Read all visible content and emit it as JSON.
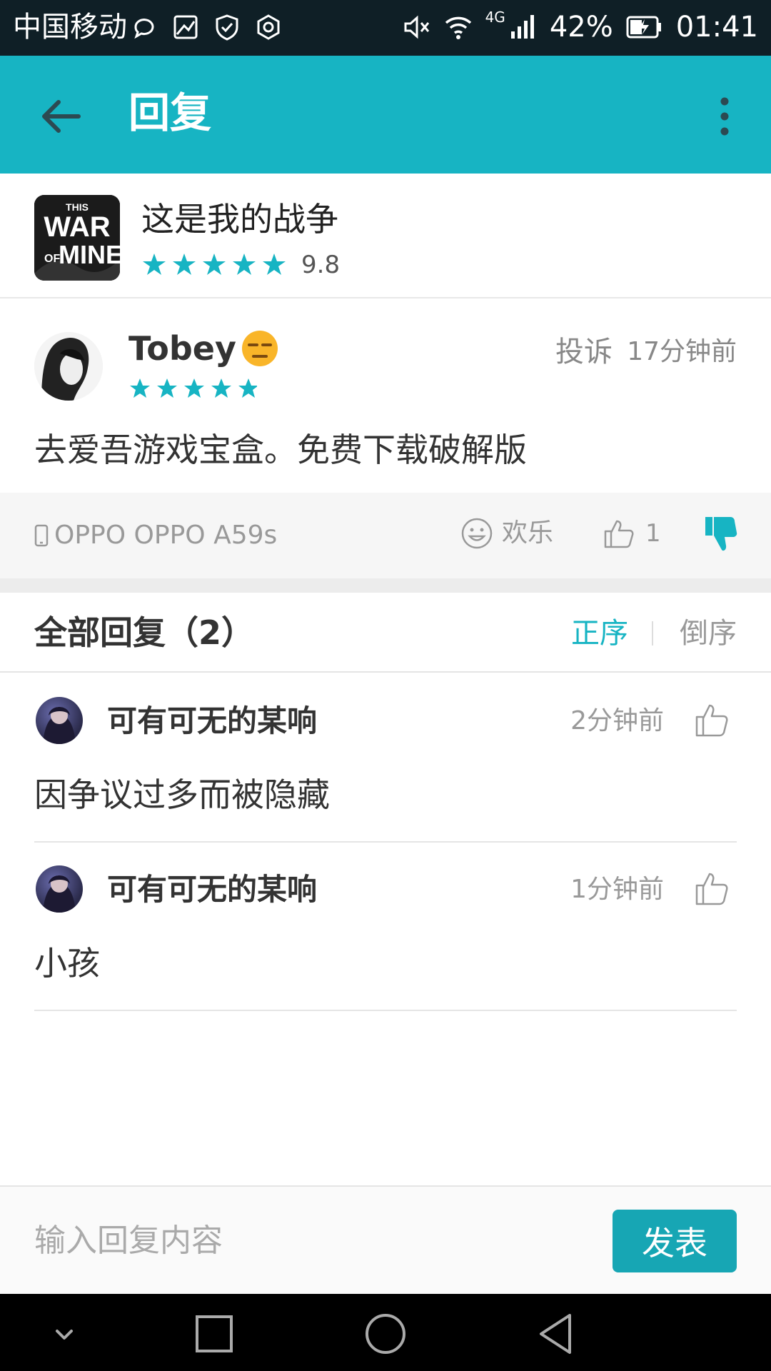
{
  "status_bar": {
    "carrier": "中国移动",
    "network": "4G",
    "battery": "42%",
    "time": "01:41"
  },
  "app_bar": {
    "title": "回复"
  },
  "game": {
    "name": "这是我的战争",
    "rating": "9.8",
    "icon_text": [
      "THIS",
      "WAR",
      "OF",
      "MINE"
    ]
  },
  "post": {
    "username": "Tobey",
    "report_label": "投诉",
    "time": "17分钟前",
    "content": "去爱吾游戏宝盒。免费下载破解版",
    "device": "OPPO OPPO A59s",
    "mood": "欢乐",
    "like_count": "1"
  },
  "replies_header": {
    "title": "全部回复（2）",
    "sort_asc": "正序",
    "sort_desc": "倒序"
  },
  "replies": [
    {
      "name": "可有可无的某响",
      "time": "2分钟前",
      "text": "因争议过多而被隐藏"
    },
    {
      "name": "可有可无的某响",
      "time": "1分钟前",
      "text": "小孩"
    }
  ],
  "input": {
    "placeholder": "输入回复内容",
    "send_label": "发表"
  },
  "colors": {
    "accent": "#17b4c3",
    "send_button": "#17a6b4"
  }
}
